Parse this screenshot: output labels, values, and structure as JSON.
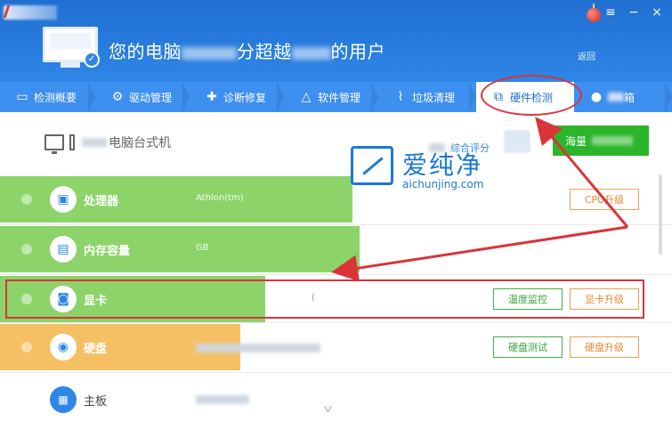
{
  "header": {
    "headline_part1": "您的电脑",
    "headline_part2": "分超越",
    "headline_part3": "的用户",
    "back_label": "返回",
    "window_controls": [
      "≡",
      "−",
      "×"
    ]
  },
  "tabs": [
    {
      "label": "检测概要",
      "icon": "monitor-icon"
    },
    {
      "label": "驱动管理",
      "icon": "gear-icon"
    },
    {
      "label": "诊断修复",
      "icon": "wrench-icon"
    },
    {
      "label": "软件管理",
      "icon": "triangle-icon"
    },
    {
      "label": "垃圾清理",
      "icon": "broom-icon"
    },
    {
      "label": "硬件检测",
      "icon": "chart-icon",
      "active": true
    },
    {
      "label": "箱",
      "icon": "toolbox-icon"
    }
  ],
  "pc": {
    "type_label": "电脑台式机"
  },
  "score": {
    "link_label": "综合评分",
    "rank_button_label": "海量"
  },
  "hardware": [
    {
      "name": "处理器",
      "value": "Athlon(tm)",
      "bar_color": "#8cd46a",
      "bar_width": 0.525,
      "buttons": [
        {
          "label": "CPU升级",
          "style": "orange"
        }
      ]
    },
    {
      "name": "内存容量",
      "value": "GB",
      "bar_color": "#8cd46a",
      "bar_width": 0.535,
      "buttons": []
    },
    {
      "name": "显卡",
      "value": "(",
      "bar_color": "#8cd46a",
      "bar_width": 0.395,
      "buttons": [
        {
          "label": "温度监控",
          "style": "green"
        },
        {
          "label": "显卡升级",
          "style": "orange"
        }
      ]
    },
    {
      "name": "硬盘",
      "value": "",
      "bar_color": "#f5c063",
      "bar_width": 0.357,
      "buttons": [
        {
          "label": "硬盘测试",
          "style": "green"
        },
        {
          "label": "硬盘升级",
          "style": "orange"
        }
      ]
    },
    {
      "name": "主板",
      "value": "",
      "bar_color": "",
      "bar_width": 0,
      "buttons": []
    }
  ],
  "watermark": {
    "cn": "爱纯净",
    "url": "aichunjing.com"
  },
  "colors": {
    "header_blue": "#1f6fd1",
    "tab_blue": "#3d8ff0",
    "bar_green": "#8cd46a",
    "bar_orange": "#f5c063",
    "annotation_red": "#d9343a",
    "rank_green": "#2bb52b"
  }
}
